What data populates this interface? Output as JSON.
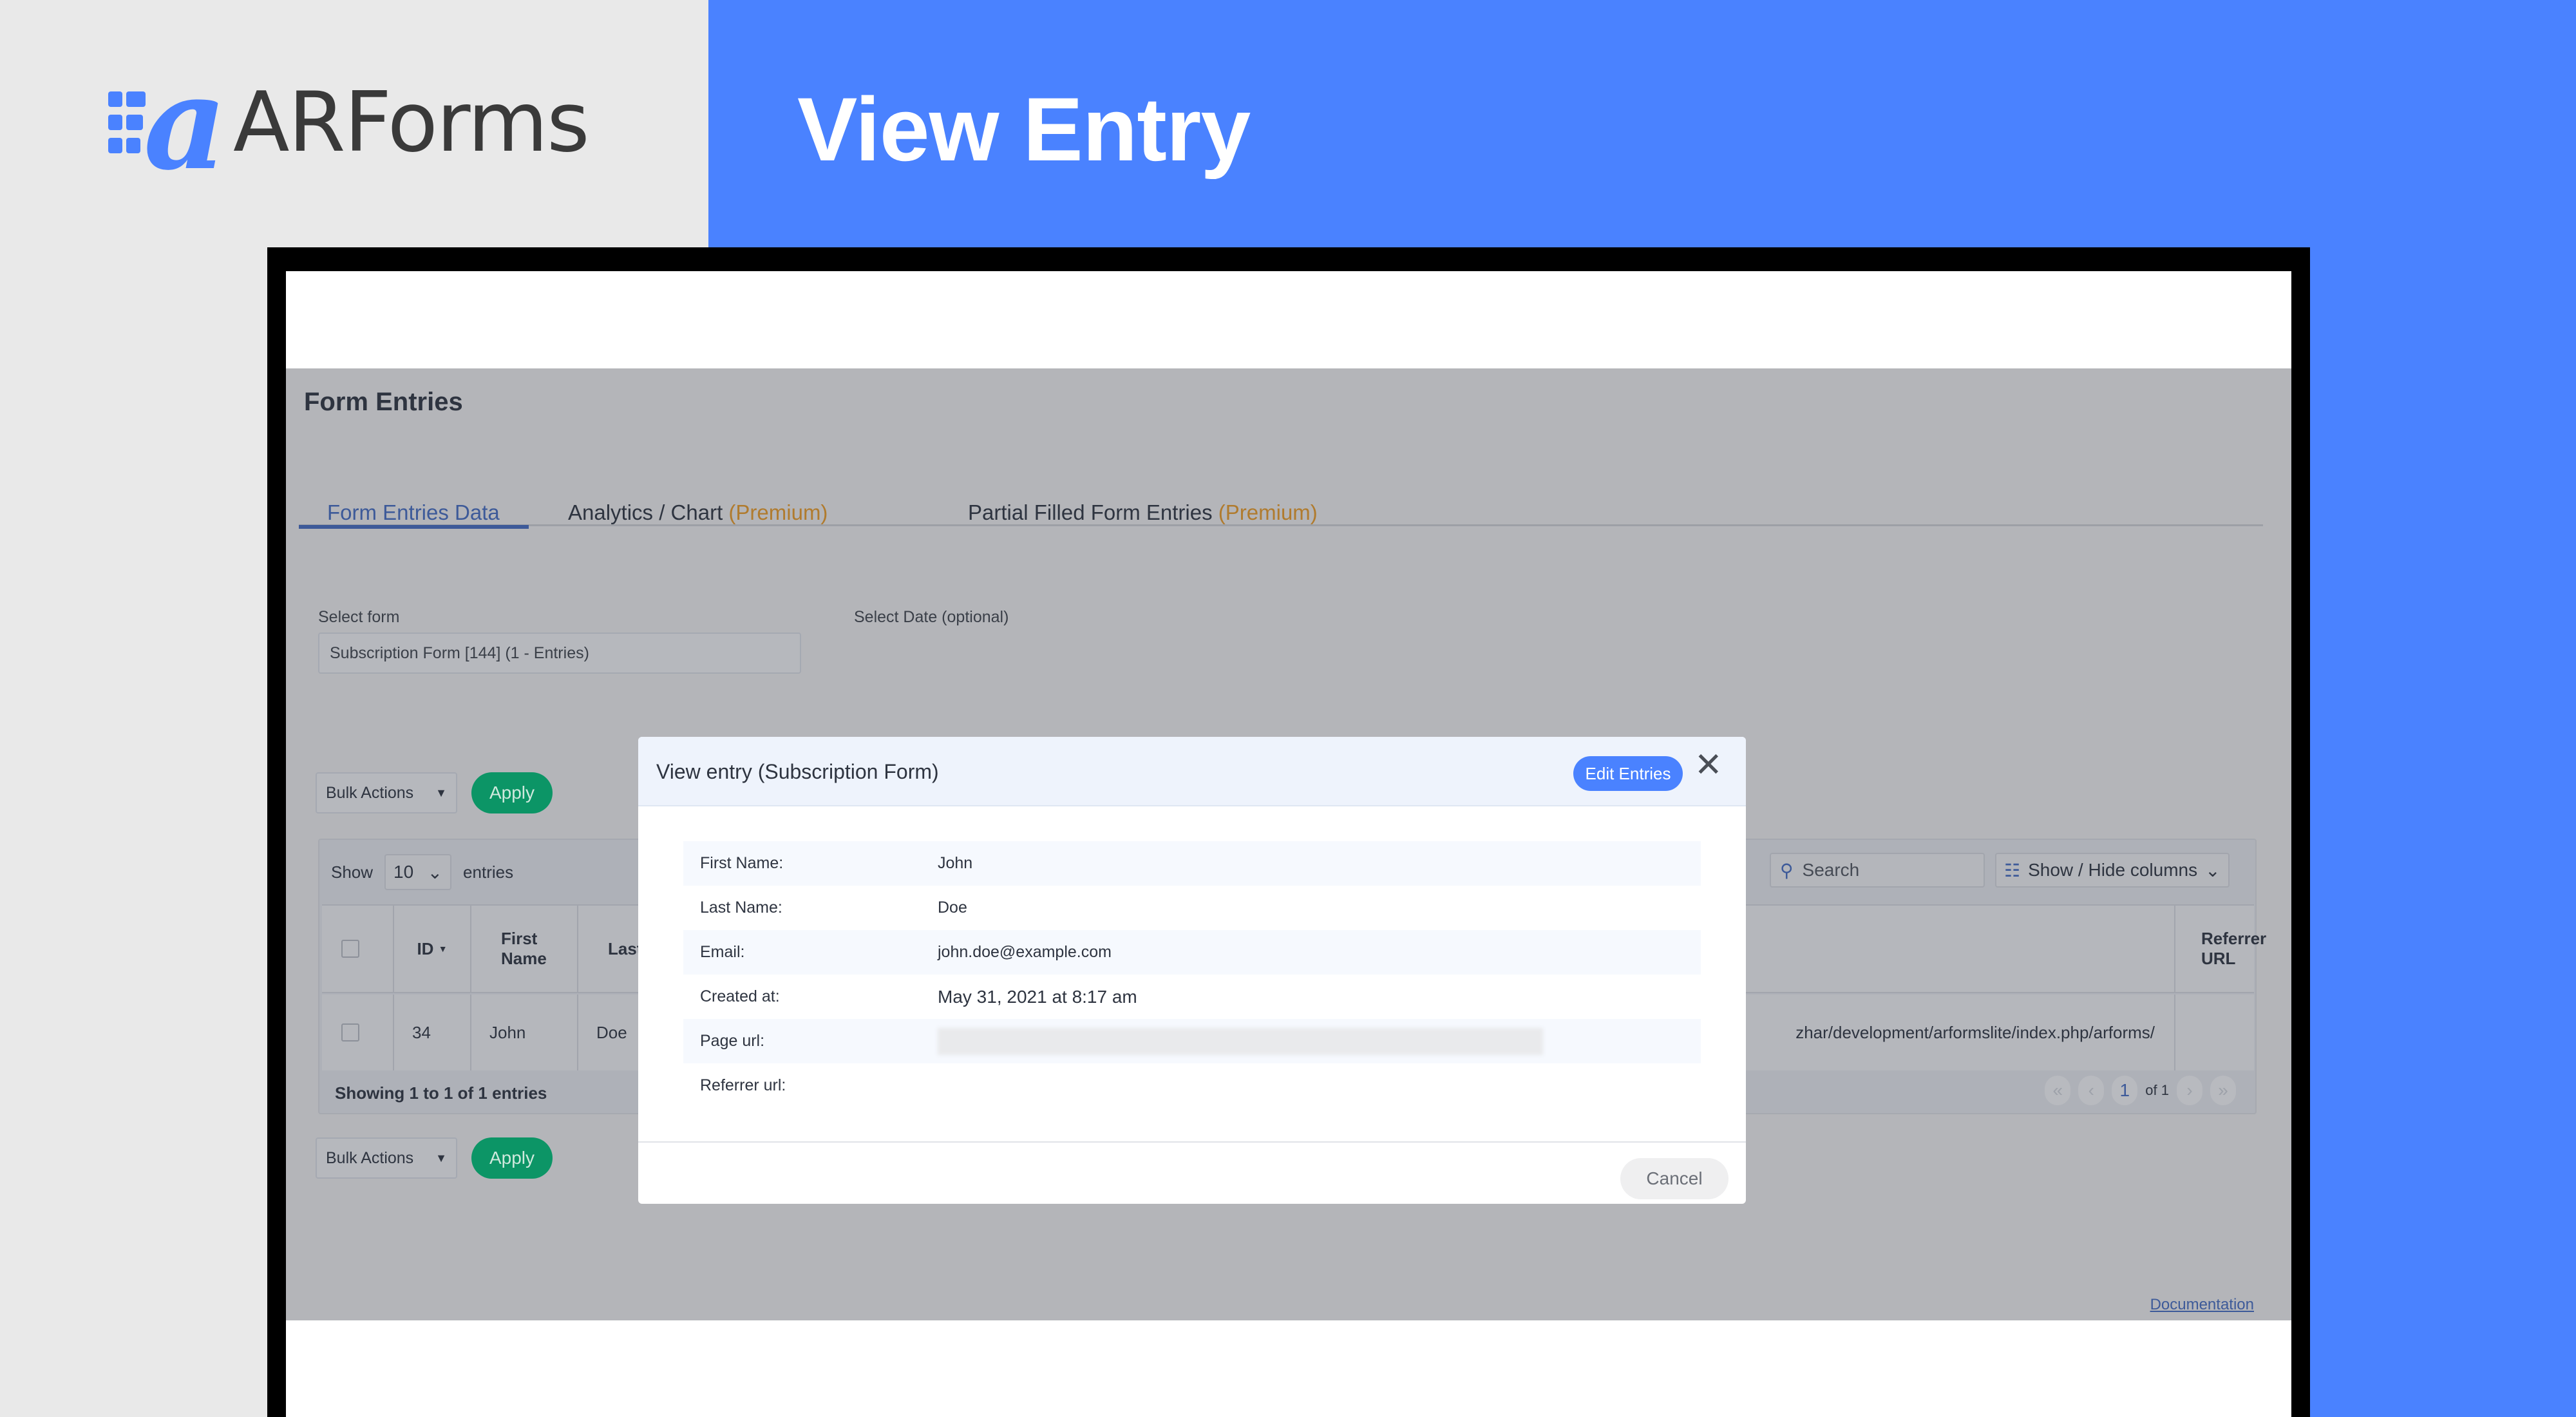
{
  "brand": {
    "name": "ARForms",
    "accent": "#4a82ff"
  },
  "hero": {
    "title": "View Entry"
  },
  "page": {
    "title": "Form Entries",
    "tabs": [
      {
        "label": "Form Entries Data",
        "badge": ""
      },
      {
        "label": "Analytics / Chart",
        "badge": "(Premium)"
      },
      {
        "label": "Partial Filled Form Entries",
        "badge": "(Premium)"
      }
    ],
    "select_form_label": "Select form",
    "select_form_value": "Subscription Form [144] (1 - Entries)",
    "select_date_label": "Select Date (optional)",
    "bulk_actions": "Bulk Actions",
    "apply": "Apply",
    "documentation": "Documentation"
  },
  "table": {
    "show_label": "Show",
    "page_length": "10",
    "entries_label": "entries",
    "search_placeholder": "Search",
    "show_hide_columns": "Show / Hide columns",
    "columns": [
      "ID",
      "First Name",
      "Last Name",
      "Referrer URL"
    ],
    "rows": [
      {
        "id": "34",
        "first_name": "John",
        "last_name": "Doe",
        "page_url": "zhar/development/arformslite/index.php/arforms/",
        "referrer_url": ""
      }
    ],
    "footer": "Showing 1 to 1 of 1 entries",
    "pager": {
      "current": "1",
      "of": "of 1"
    }
  },
  "modal": {
    "title": "View entry (Subscription Form)",
    "edit_button": "Edit Entries",
    "cancel_button": "Cancel",
    "fields": [
      {
        "label": "First Name:",
        "value": "John"
      },
      {
        "label": "Last Name:",
        "value": "Doe"
      },
      {
        "label": "Email:",
        "value": "john.doe@example.com"
      },
      {
        "label": "Created at:",
        "value": "May 31, 2021 at 8:17 am"
      },
      {
        "label": "Page url:",
        "value": ""
      },
      {
        "label": "Referrer url:",
        "value": ""
      }
    ]
  }
}
